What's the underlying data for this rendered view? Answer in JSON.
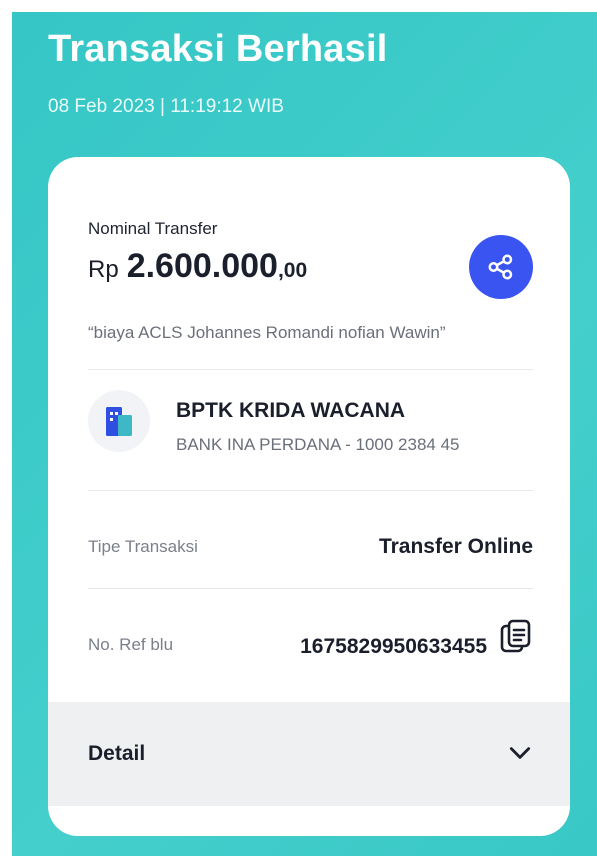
{
  "header": {
    "title": "Transaksi Berhasil",
    "datetime": "08 Feb 2023  |  11:19:12 WIB"
  },
  "transfer": {
    "nominal_label": "Nominal Transfer",
    "currency": "Rp",
    "amount": "2.600.000",
    "decimals": ",00",
    "note": "“biaya ACLS Johannes Romandi nofian Wawin”"
  },
  "recipient": {
    "name": "BPTK KRIDA WACANA",
    "bank_account": "BANK INA PERDANA - 1000 2384 45"
  },
  "details": {
    "type_label": "Tipe Transaksi",
    "type_value": "Transfer Online",
    "ref_label": "No. Ref blu",
    "ref_value": "1675829950633455"
  },
  "detail_section": {
    "label": "Detail"
  },
  "colors": {
    "background": "#3ec9c7",
    "accent": "#3a54f1",
    "card": "#ffffff"
  },
  "icons": {
    "share": "share-icon",
    "bank_logo": "building-icon",
    "copy": "copy-icon",
    "expand": "chevron-down-icon"
  }
}
